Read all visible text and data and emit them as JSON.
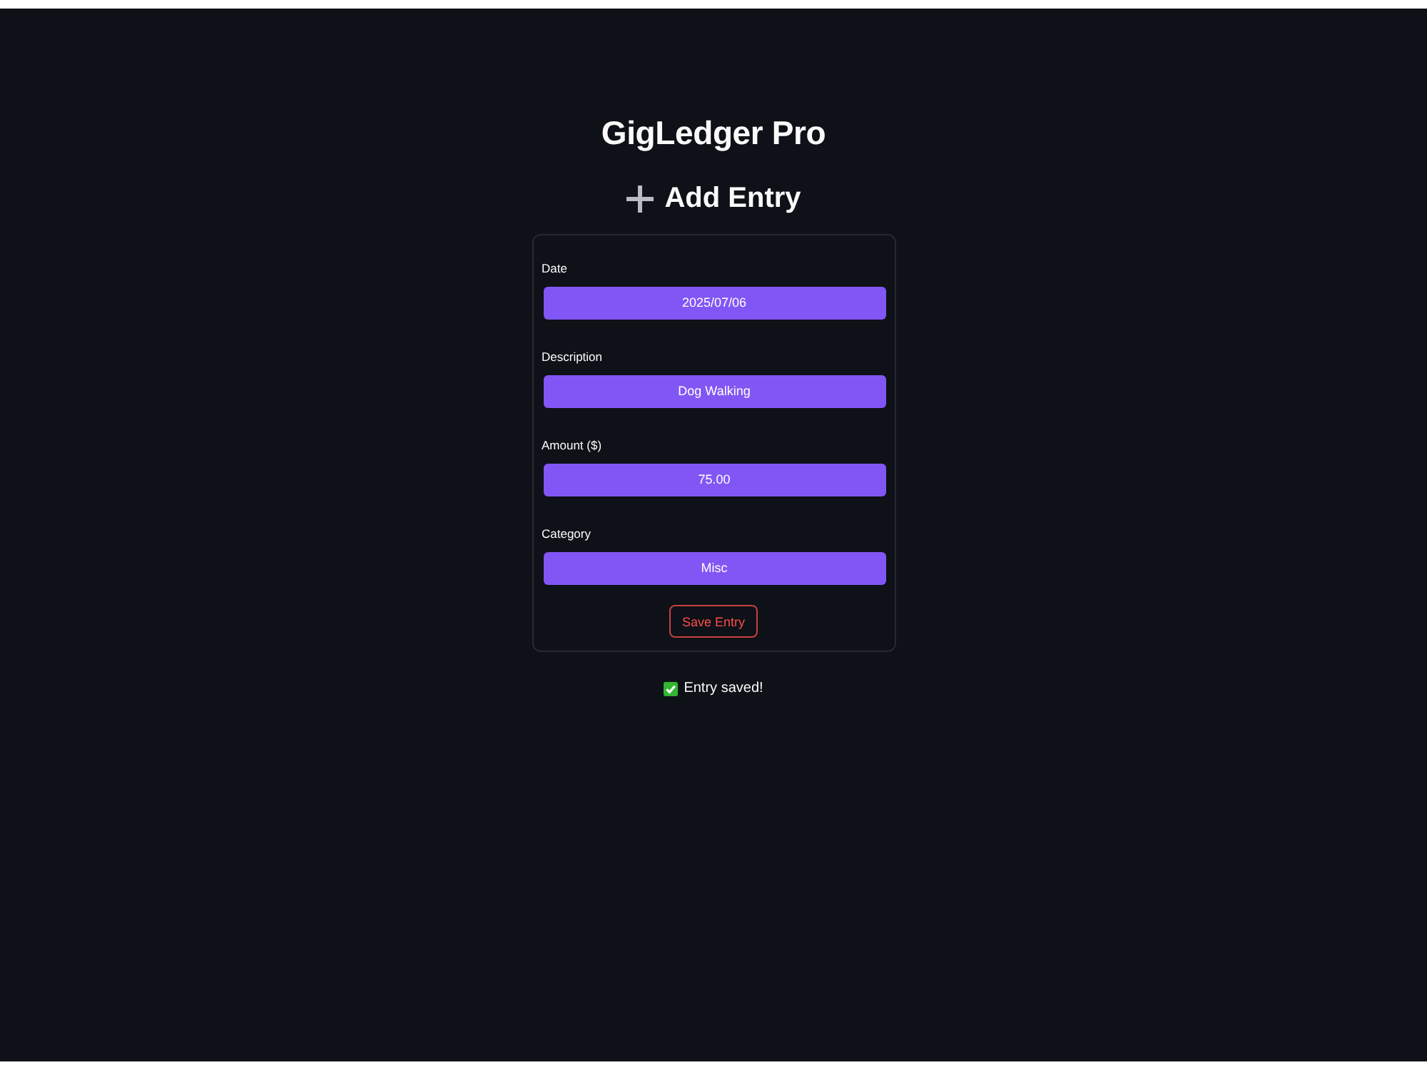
{
  "app": {
    "title": "GigLedger Pro"
  },
  "form": {
    "heading": "Add Entry",
    "fields": [
      {
        "label": "Date",
        "value": "2025/07/06"
      },
      {
        "label": "Description",
        "value": "Dog Walking"
      },
      {
        "label": "Amount ($)",
        "value": "75.00"
      },
      {
        "label": "Category",
        "value": "Misc"
      }
    ],
    "submit": "Save Entry"
  },
  "status": {
    "message": "Entry saved!"
  }
}
